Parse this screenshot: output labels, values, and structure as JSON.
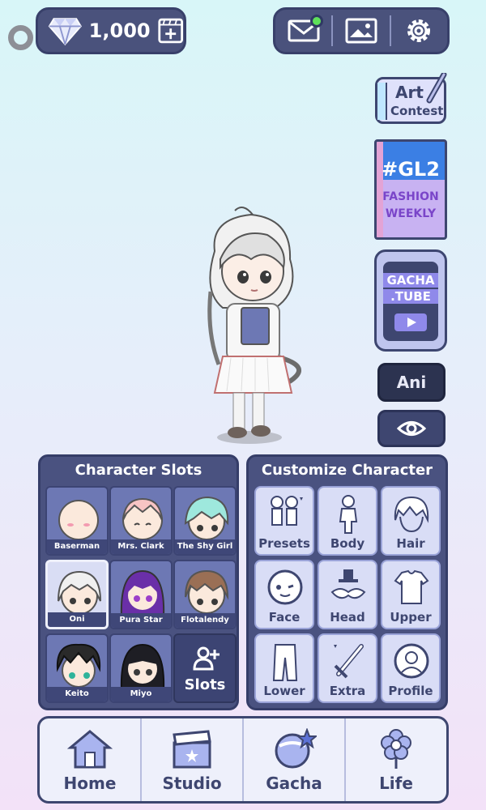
{
  "currency": {
    "amount": "1,000"
  },
  "side": {
    "art_contest": {
      "line1": "Art",
      "line2": "Contest"
    },
    "fashion_weekly": {
      "tag": "#GL2",
      "line1": "FASHION",
      "line2": "WEEKLY"
    },
    "gacha_tube": {
      "line1": "GACHA",
      "line2": ".TUBE"
    },
    "ani_label": "Ani"
  },
  "slots_panel": {
    "title": "Character Slots",
    "slots": [
      {
        "name": "Baserman"
      },
      {
        "name": "Mrs. Clark"
      },
      {
        "name": "The Shy Girl"
      },
      {
        "name": "Oni"
      },
      {
        "name": "Pura Star"
      },
      {
        "name": "Flotalendy"
      },
      {
        "name": "Keito"
      },
      {
        "name": "Miyo"
      }
    ],
    "add_label": "Slots"
  },
  "customize_panel": {
    "title": "Customize Character",
    "tiles": [
      {
        "label": "Presets"
      },
      {
        "label": "Body"
      },
      {
        "label": "Hair"
      },
      {
        "label": "Face"
      },
      {
        "label": "Head"
      },
      {
        "label": "Upper"
      },
      {
        "label": "Lower"
      },
      {
        "label": "Extra"
      },
      {
        "label": "Profile"
      }
    ]
  },
  "nav": {
    "items": [
      {
        "label": "Home"
      },
      {
        "label": "Studio"
      },
      {
        "label": "Gacha"
      },
      {
        "label": "Life"
      }
    ]
  },
  "icons": [
    "diamond-icon",
    "add-video-icon",
    "mail-icon",
    "gallery-icon",
    "settings-gear-icon",
    "eye-icon",
    "add-person-icon",
    "home-icon",
    "clapperboard-icon",
    "gacha-orb-icon",
    "flower-icon"
  ],
  "colors": {
    "panel": "#4a5280",
    "accent": "#3e4670",
    "notification": "#5ee05a"
  }
}
